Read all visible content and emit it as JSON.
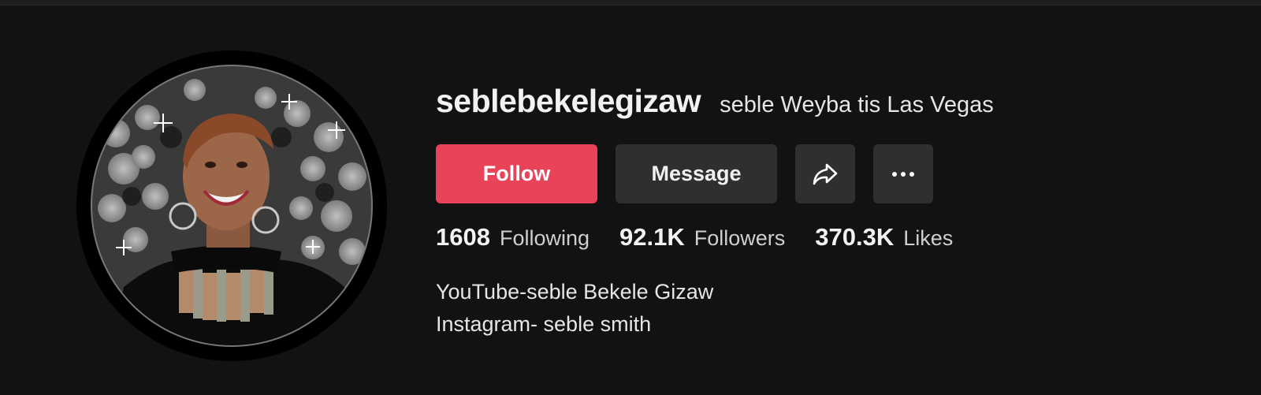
{
  "profile": {
    "username": "seblebekelegizaw",
    "nickname": "seble Weyba tis Las Vegas",
    "avatar_icon": "profile-photo"
  },
  "actions": {
    "follow_label": "Follow",
    "message_label": "Message",
    "share_icon": "share-arrow-icon",
    "more_icon": "more-dots-icon",
    "follow_color": "#e9435a"
  },
  "stats": [
    {
      "value": "1608",
      "label": "Following"
    },
    {
      "value": "92.1K",
      "label": "Followers"
    },
    {
      "value": "370.3K",
      "label": "Likes"
    }
  ],
  "bio": [
    "YouTube-seble Bekele Gizaw",
    "Instagram- seble smith"
  ]
}
